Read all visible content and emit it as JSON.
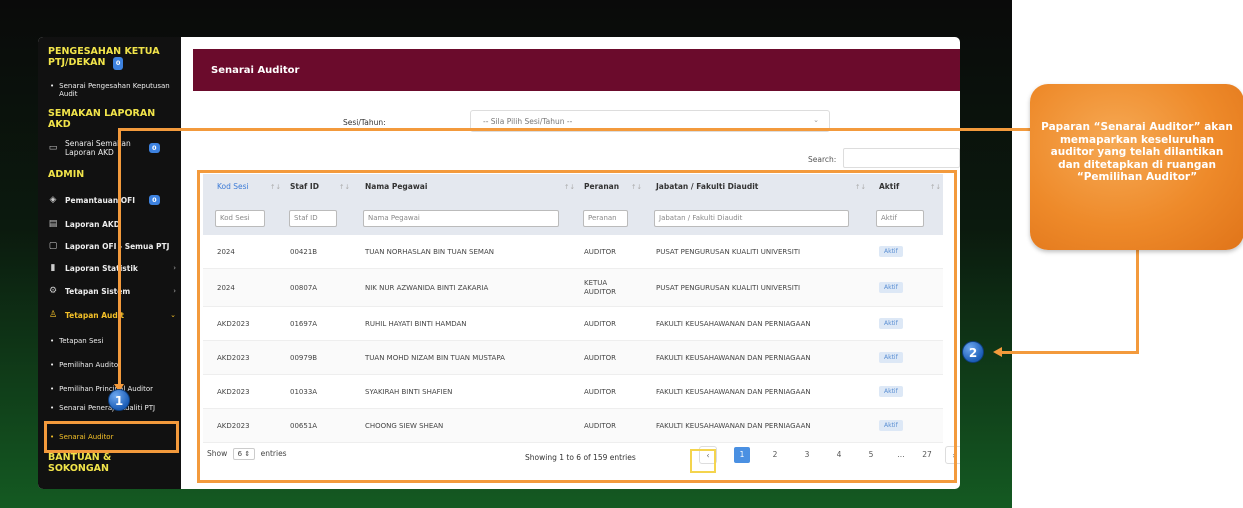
{
  "sidebar": {
    "section1_title": "PENGESAHAN KETUA PTJ/DEKAN",
    "section1_badge": "0",
    "section1_sub": "Senarai Pengesahan Keputusan Audit",
    "section2_title": "SEMAKAN LAPORAN AKD",
    "section2_item": "Senarai Semakan Laporan AKD",
    "section2_badge": "0",
    "section3_title": "ADMIN",
    "items": [
      {
        "label": "Pemantauan OFI",
        "badge": "0",
        "icon": "binoculars-icon"
      },
      {
        "label": "Laporan AKD",
        "icon": "document-icon"
      },
      {
        "label": "Laporan OFI - Semua PTJ",
        "icon": "file-icon"
      },
      {
        "label": "Laporan Statistik",
        "icon": "chart-icon"
      },
      {
        "label": "Tetapan Sistem",
        "icon": "gear-icon"
      },
      {
        "label": "Tetapan Audit",
        "icon": "user-icon"
      }
    ],
    "sub_items": [
      "Tetapan Sesi",
      "Pemilihan Auditor",
      "Pemilihan Principal Auditor",
      "Senarai Peneraju Kualiti PTJ",
      "Senarai Auditor"
    ],
    "section4_title": "BANTUAN & SOKONGAN"
  },
  "header": {
    "title": "Senarai Auditor"
  },
  "filter": {
    "sesi_label": "Sesi/Tahun:",
    "sesi_placeholder": "-- Sila Pilih Sesi/Tahun --",
    "search_label": "Search:"
  },
  "table": {
    "columns": [
      "Kod Sesi",
      "Staf ID",
      "Nama Pegawai",
      "Peranan",
      "Jabatan / Fakulti Diaudit",
      "Aktif"
    ],
    "filters": [
      "Kod Sesi",
      "Staf ID",
      "Nama Pegawai",
      "Peranan",
      "Jabatan / Fakulti Diaudit",
      "Aktif"
    ],
    "rows": [
      {
        "kod": "2024",
        "staf": "00421B",
        "nama": "TUAN NORHASLAN BIN TUAN SEMAN",
        "peranan": "AUDITOR",
        "jabatan": "PUSAT PENGURUSAN KUALITI UNIVERSITI",
        "aktif": "Aktif"
      },
      {
        "kod": "2024",
        "staf": "00807A",
        "nama": "NIK NUR AZWANIDA BINTI ZAKARIA",
        "peranan": "KETUA AUDITOR",
        "jabatan": "PUSAT PENGURUSAN KUALITI UNIVERSITI",
        "aktif": "Aktif"
      },
      {
        "kod": "AKD2023",
        "staf": "01697A",
        "nama": "RUHIL HAYATI BINTI HAMDAN",
        "peranan": "AUDITOR",
        "jabatan": "FAKULTI KEUSAHAWANAN DAN PERNIAGAAN",
        "aktif": "Aktif"
      },
      {
        "kod": "AKD2023",
        "staf": "00979B",
        "nama": "TUAN MOHD NIZAM BIN TUAN MUSTAPA",
        "peranan": "AUDITOR",
        "jabatan": "FAKULTI KEUSAHAWANAN DAN PERNIAGAAN",
        "aktif": "Aktif"
      },
      {
        "kod": "AKD2023",
        "staf": "01033A",
        "nama": "SYAKIRAH BINTI SHAFIEN",
        "peranan": "AUDITOR",
        "jabatan": "FAKULTI KEUSAHAWANAN DAN PERNIAGAAN",
        "aktif": "Aktif"
      },
      {
        "kod": "AKD2023",
        "staf": "00651A",
        "nama": "CHOONG SIEW SHEAN",
        "peranan": "AUDITOR",
        "jabatan": "FAKULTI KEUSAHAWANAN DAN PERNIAGAAN",
        "aktif": "Aktif"
      }
    ]
  },
  "footer": {
    "show_prefix": "Show",
    "show_value": "6",
    "show_suffix": "entries",
    "showing": "Showing 1 to 6 of 159 entries",
    "pages": [
      "1",
      "2",
      "3",
      "4",
      "5",
      "...",
      "27"
    ],
    "prev": "‹",
    "next": "›"
  },
  "annotations": {
    "marker1": "1",
    "marker2": "2",
    "callout": "Paparan “Senarai Auditor” akan memaparkan keseluruhan auditor yang telah dilantikan dan ditetapkan di ruangan “Pemilihan Auditor”"
  },
  "colors": {
    "titlebar": "#6b0b2c",
    "accent_orange": "#f39a3c",
    "sidebar_bg": "#111111",
    "badge_blue": "#3d82e0"
  }
}
